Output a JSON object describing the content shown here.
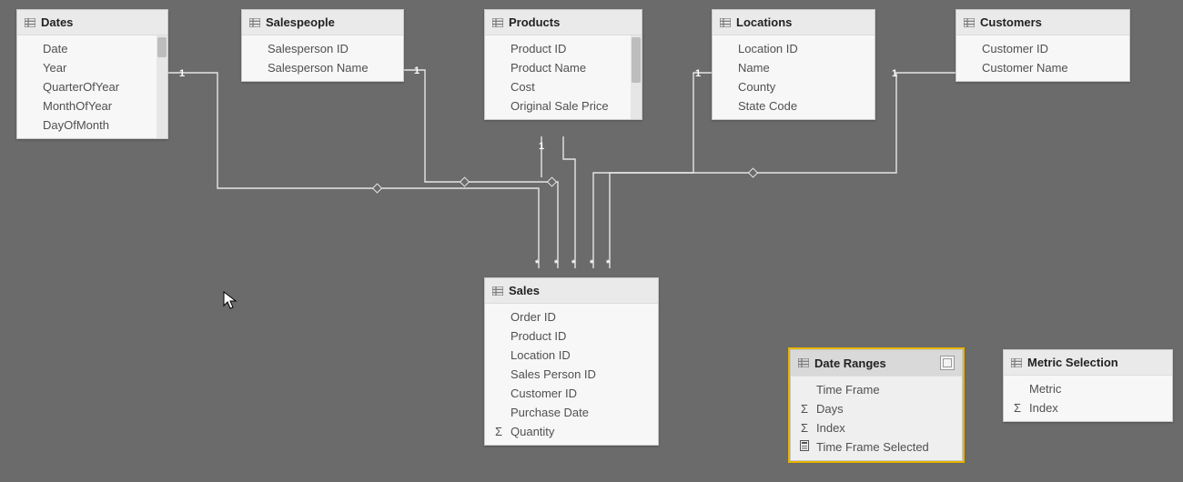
{
  "tables": {
    "dates": {
      "title": "Dates",
      "scroll": true,
      "thumbTop": 2,
      "thumbH": 22,
      "fields": [
        {
          "label": "Date"
        },
        {
          "label": "Year"
        },
        {
          "label": "QuarterOfYear"
        },
        {
          "label": "MonthOfYear"
        },
        {
          "label": "DayOfMonth"
        }
      ]
    },
    "salespeople": {
      "title": "Salespeople",
      "fields": [
        {
          "label": "Salesperson ID"
        },
        {
          "label": "Salesperson Name"
        }
      ]
    },
    "products": {
      "title": "Products",
      "scroll": true,
      "thumbTop": 2,
      "thumbH": 50,
      "fields": [
        {
          "label": "Product ID"
        },
        {
          "label": "Product Name"
        },
        {
          "label": "Cost"
        },
        {
          "label": "Original Sale Price"
        }
      ]
    },
    "locations": {
      "title": "Locations",
      "fields": [
        {
          "label": "Location ID"
        },
        {
          "label": "Name"
        },
        {
          "label": "County"
        },
        {
          "label": "State Code"
        }
      ]
    },
    "customers": {
      "title": "Customers",
      "fields": [
        {
          "label": "Customer ID"
        },
        {
          "label": "Customer Name"
        }
      ]
    },
    "sales": {
      "title": "Sales",
      "fields": [
        {
          "label": "Order ID"
        },
        {
          "label": "Product ID"
        },
        {
          "label": "Location ID"
        },
        {
          "label": "Sales Person ID"
        },
        {
          "label": "Customer ID"
        },
        {
          "label": "Purchase Date"
        },
        {
          "label": "Quantity",
          "icon": "Σ"
        }
      ]
    },
    "dateranges": {
      "title": "Date Ranges",
      "selected": true,
      "fields": [
        {
          "label": "Time Frame"
        },
        {
          "label": "Days",
          "icon": "Σ"
        },
        {
          "label": "Index",
          "icon": "Σ"
        },
        {
          "label": "Time Frame Selected",
          "icon": "calc"
        }
      ]
    },
    "metric": {
      "title": "Metric Selection",
      "fields": [
        {
          "label": "Metric"
        },
        {
          "label": "Index",
          "icon": "Σ"
        }
      ]
    }
  },
  "endpoints": {
    "one": "1",
    "many": "*"
  }
}
